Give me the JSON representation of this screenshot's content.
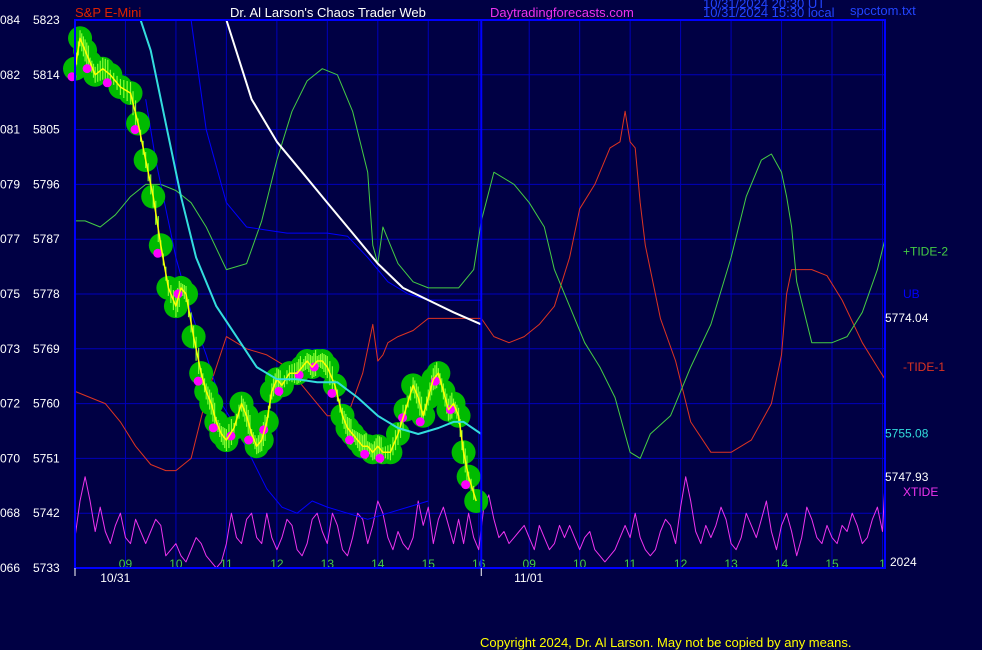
{
  "header": {
    "symbol": "S&P E-Mini",
    "title": "Dr. Al Larson's Chaos Trader Web",
    "site": "Daytradingforecasts.com",
    "ut_line": "10/31/2024 20:30 UT",
    "local_line": "10/31/2024 15:30 local",
    "file": "spcctom.txt"
  },
  "footer": {
    "copyright": "Copyright 2024, Dr. Al Larson. May not be copied by any means."
  },
  "colors": {
    "background": "#000044",
    "grid": "#0000bb",
    "axis": "#0000ff",
    "price": "#ffff00",
    "band": "#00bb00",
    "dots": "#ff00ff",
    "cyan": "#33dddd",
    "white": "#ffffff",
    "blue": "#0000ff",
    "tide_plus": "#44cc44",
    "tide_minus": "#dd3322",
    "xtide": "#ee33ee"
  },
  "chart_data": {
    "type": "line",
    "x_unit": "hour",
    "x_ticks": [
      {
        "hour": 9,
        "label": "09"
      },
      {
        "hour": 10,
        "label": "10"
      },
      {
        "hour": 11,
        "label": "11"
      },
      {
        "hour": 12,
        "label": "12"
      },
      {
        "hour": 13,
        "label": "13"
      },
      {
        "hour": 14,
        "label": "14"
      },
      {
        "hour": 15,
        "label": "15"
      },
      {
        "hour": 16,
        "label": "16"
      },
      {
        "hour": 17,
        "label": "09"
      },
      {
        "hour": 18,
        "label": "10"
      },
      {
        "hour": 19,
        "label": "11"
      },
      {
        "hour": 20,
        "label": "12"
      },
      {
        "hour": 21,
        "label": "13"
      },
      {
        "hour": 22,
        "label": "14"
      },
      {
        "hour": 23,
        "label": "15"
      },
      {
        "hour": 24,
        "label": "1"
      }
    ],
    "date_labels": [
      {
        "hour": 8.5,
        "label": "10/31"
      },
      {
        "hour": 16.7,
        "label": "11/01"
      }
    ],
    "year_label": "2024",
    "xlim": [
      8,
      24.05
    ],
    "ylim": [
      5733,
      5823
    ],
    "y_ticks": [
      {
        "value": 5823,
        "code": "084",
        "label": "5823"
      },
      {
        "value": 5814,
        "code": "082",
        "label": "5814"
      },
      {
        "value": 5805,
        "code": "081",
        "label": "5805"
      },
      {
        "value": 5796,
        "code": "079",
        "label": "5796"
      },
      {
        "value": 5787,
        "code": "077",
        "label": "5787"
      },
      {
        "value": 5778,
        "code": "075",
        "label": "5778"
      },
      {
        "value": 5769,
        "code": "073",
        "label": "5769"
      },
      {
        "value": 5760,
        "code": "072",
        "label": "5760"
      },
      {
        "value": 5751,
        "code": "070",
        "label": "5751"
      },
      {
        "value": 5742,
        "code": "068",
        "label": "5742"
      },
      {
        "value": 5733,
        "code": "066",
        "label": "5733"
      }
    ],
    "divider_hour": 16.05,
    "right_labels": [
      {
        "text": "+TIDE-2",
        "value": 5785,
        "color": "#44cc44"
      },
      {
        "text": "UB",
        "value": 5778,
        "color": "#0000ff"
      },
      {
        "text": "5774.04",
        "value": 5774.04,
        "color": "#ffffff"
      },
      {
        "text": "-TIDE-1",
        "value": 5766,
        "color": "#dd3322"
      },
      {
        "text": "5755.08",
        "value": 5755.08,
        "color": "#33dddd"
      },
      {
        "text": "5747.93",
        "value": 5747.93,
        "color": "#ffffff"
      },
      {
        "text": "XTIDE",
        "value": 5745.5,
        "color": "#ee33ee"
      }
    ],
    "series": [
      {
        "key": "price",
        "x": [
          8,
          8.1,
          8.2,
          8.3,
          8.4,
          8.55,
          8.7,
          8.9,
          9.1,
          9.25,
          9.4,
          9.55,
          9.7,
          9.85,
          10,
          10.1,
          10.2,
          10.35,
          10.5,
          10.6,
          10.7,
          10.8,
          10.9,
          11,
          11.15,
          11.3,
          11.4,
          11.5,
          11.6,
          11.7,
          11.8,
          11.9,
          12,
          12.1,
          12.25,
          12.4,
          12.5,
          12.6,
          12.7,
          12.8,
          12.9,
          13,
          13.15,
          13.3,
          13.4,
          13.5,
          13.6,
          13.7,
          13.8,
          13.9,
          14,
          14.1,
          14.25,
          14.4,
          14.55,
          14.7,
          14.8,
          14.9,
          15,
          15.1,
          15.2,
          15.3,
          15.4,
          15.5,
          15.6,
          15.7,
          15.8,
          15.95
        ],
        "y": [
          5815,
          5820,
          5818,
          5816,
          5814,
          5815,
          5814,
          5812,
          5811,
          5806,
          5800,
          5794,
          5786,
          5779,
          5776,
          5779,
          5778,
          5771,
          5765,
          5762,
          5760,
          5757,
          5755,
          5754,
          5756,
          5760,
          5758,
          5755,
          5753,
          5754,
          5757,
          5762,
          5764,
          5763,
          5765,
          5765,
          5766,
          5767,
          5766,
          5767,
          5767,
          5766,
          5763,
          5758,
          5756,
          5755,
          5754,
          5753,
          5753,
          5752,
          5753,
          5752,
          5752,
          5755,
          5759,
          5763,
          5761,
          5758,
          5761,
          5764,
          5765,
          5762,
          5759,
          5760,
          5758,
          5752,
          5748,
          5744
        ]
      },
      {
        "key": "cyan_avg",
        "x": [
          9.3,
          9.5,
          9.8,
          10.1,
          10.4,
          10.8,
          11.2,
          11.6,
          12,
          12.4,
          12.8,
          13.2,
          13.6,
          14,
          14.4,
          14.8,
          15.2,
          15.5,
          15.7,
          16.05
        ],
        "y": [
          5823,
          5818,
          5806,
          5794,
          5784,
          5776,
          5771,
          5766,
          5764,
          5764,
          5763.5,
          5763.5,
          5761,
          5758,
          5756,
          5755,
          5756,
          5757,
          5757,
          5755
        ]
      },
      {
        "key": "white_avg",
        "x": [
          11,
          11.5,
          12,
          12.5,
          13,
          13.5,
          14,
          14.5,
          15,
          15.5,
          16.05
        ],
        "y": [
          5823,
          5810,
          5803,
          5798,
          5793,
          5788,
          5783,
          5779,
          5777,
          5775,
          5773
        ]
      },
      {
        "key": "ub_line",
        "x": [
          10.3,
          10.6,
          11,
          11.4,
          11.8,
          12.2,
          12.6,
          13,
          13.4,
          13.8,
          14.2,
          14.6,
          15,
          15.4,
          15.8,
          16.05
        ],
        "y": [
          5823,
          5805,
          5793,
          5789,
          5788.5,
          5788,
          5788,
          5788,
          5787.5,
          5784,
          5780,
          5778,
          5777,
          5777,
          5777,
          5777
        ]
      },
      {
        "key": "lb_line",
        "x": [
          9.4,
          9.6,
          9.8,
          10,
          10.3,
          10.6,
          10.9,
          11.2,
          11.5,
          11.8,
          12.1,
          12.4,
          12.7,
          13,
          13.4,
          13.8,
          14.2,
          14.6,
          15
        ],
        "y": [
          5810,
          5800,
          5792,
          5784,
          5775,
          5768,
          5760,
          5756,
          5751,
          5746,
          5743,
          5742,
          5744,
          5743,
          5742,
          5741,
          5742,
          5743,
          5744
        ]
      },
      {
        "key": "tide_plus",
        "x": [
          8,
          8.2,
          8.5,
          8.8,
          9.1,
          9.4,
          9.7,
          10,
          10.3,
          10.6,
          11,
          11.4,
          11.7,
          12,
          12.3,
          12.6,
          12.9,
          13.2,
          13.5,
          13.8,
          13.9,
          14,
          14.1,
          14.2,
          14.4,
          14.7,
          15,
          15.3,
          15.6,
          15.9,
          16.05,
          16.3,
          16.7,
          17,
          17.3,
          17.5,
          17.8,
          18.1,
          18.4,
          18.7,
          19,
          19.2,
          19.4,
          19.8,
          20.2,
          20.6,
          21,
          21.3,
          21.6,
          21.8,
          22,
          22.1,
          22.2,
          22.3,
          22.6,
          23,
          23.3,
          23.6,
          23.9,
          24.05
        ],
        "y": [
          5790,
          5790,
          5789,
          5791,
          5794,
          5796,
          5796,
          5795,
          5793,
          5789,
          5782,
          5783,
          5790,
          5800,
          5808,
          5813,
          5815,
          5814,
          5808,
          5798,
          5786,
          5783,
          5789,
          5787,
          5783,
          5780,
          5779,
          5779,
          5779,
          5782,
          5790,
          5798,
          5796,
          5793,
          5789,
          5782,
          5776,
          5770,
          5766,
          5761,
          5752,
          5751,
          5755,
          5758,
          5766,
          5773,
          5784,
          5794,
          5800,
          5801,
          5798,
          5794,
          5789,
          5780,
          5770,
          5770,
          5771,
          5775,
          5782,
          5787
        ]
      },
      {
        "key": "tide_minus",
        "x": [
          8,
          8.3,
          8.6,
          8.9,
          9.2,
          9.5,
          9.8,
          10,
          10.3,
          10.6,
          11,
          11.4,
          11.8,
          12.2,
          12.6,
          13,
          13.4,
          13.7,
          13.9,
          14,
          14.1,
          14.2,
          14.4,
          14.7,
          15,
          15.3,
          15.6,
          15.9,
          16.05,
          16.3,
          16.6,
          16.9,
          17.2,
          17.5,
          17.8,
          18,
          18.3,
          18.6,
          18.8,
          18.9,
          19,
          19.1,
          19.2,
          19.3,
          19.6,
          19.9,
          20.2,
          20.6,
          21,
          21.4,
          21.8,
          22,
          22.1,
          22.2,
          22.3,
          22.6,
          22.9,
          23.2,
          23.6,
          23.9,
          24.05
        ],
        "y": [
          5762,
          5761,
          5760,
          5757,
          5753,
          5750,
          5749,
          5749,
          5751,
          5761,
          5771,
          5769,
          5768,
          5766,
          5762,
          5758,
          5758,
          5765,
          5773,
          5767,
          5768,
          5770,
          5771,
          5772,
          5774,
          5774,
          5774,
          5774,
          5774,
          5771,
          5770,
          5771,
          5773,
          5776,
          5784,
          5792,
          5796,
          5802,
          5803,
          5808,
          5803,
          5802,
          5793,
          5786,
          5774,
          5767,
          5757,
          5752,
          5752,
          5754,
          5760,
          5768,
          5778,
          5782,
          5782,
          5782,
          5781,
          5777,
          5770,
          5766,
          5764
        ]
      },
      {
        "key": "xtide",
        "x": [
          8,
          8.1,
          8.2,
          8.3,
          8.4,
          8.5,
          8.6,
          8.7,
          8.8,
          8.9,
          9,
          9.1,
          9.2,
          9.3,
          9.4,
          9.5,
          9.6,
          9.7,
          9.8,
          9.9,
          10,
          10.1,
          10.2,
          10.3,
          10.4,
          10.5,
          10.6,
          10.7,
          10.8,
          10.9,
          11,
          11.1,
          11.2,
          11.3,
          11.4,
          11.5,
          11.6,
          11.7,
          11.8,
          11.9,
          12,
          12.1,
          12.2,
          12.3,
          12.4,
          12.5,
          12.6,
          12.7,
          12.8,
          12.9,
          13,
          13.1,
          13.2,
          13.3,
          13.4,
          13.5,
          13.6,
          13.7,
          13.8,
          13.9,
          14,
          14.1,
          14.2,
          14.3,
          14.4,
          14.5,
          14.6,
          14.7,
          14.8,
          14.9,
          15,
          15.1,
          15.2,
          15.3,
          15.4,
          15.5,
          15.6,
          15.7,
          15.8,
          15.9,
          16,
          16.1,
          16.2,
          16.3,
          16.4,
          16.5,
          16.6,
          16.7,
          16.8,
          16.9,
          17,
          17.1,
          17.2,
          17.3,
          17.4,
          17.5,
          17.6,
          17.7,
          17.8,
          17.9,
          18,
          18.1,
          18.2,
          18.3,
          18.4,
          18.5,
          18.6,
          18.7,
          18.8,
          18.9,
          19,
          19.1,
          19.2,
          19.3,
          19.4,
          19.5,
          19.6,
          19.7,
          19.8,
          19.9,
          20,
          20.1,
          20.2,
          20.3,
          20.4,
          20.5,
          20.6,
          20.7,
          20.8,
          20.9,
          21,
          21.1,
          21.2,
          21.3,
          21.4,
          21.5,
          21.6,
          21.7,
          21.8,
          21.9,
          22,
          22.1,
          22.2,
          22.3,
          22.4,
          22.5,
          22.6,
          22.7,
          22.8,
          22.9,
          23,
          23.1,
          23.2,
          23.3,
          23.4,
          23.5,
          23.6,
          23.7,
          23.8,
          23.9,
          24,
          24.05
        ],
        "y": [
          5738,
          5744,
          5748,
          5744,
          5739,
          5743,
          5739,
          5737,
          5740,
          5742,
          5738,
          5737,
          5741,
          5739,
          5737,
          5739,
          5741,
          5740,
          5735,
          5736,
          5737,
          5735,
          5734,
          5736,
          5738,
          5737,
          5735,
          5734,
          5733,
          5734,
          5737,
          5742,
          5738,
          5737,
          5741,
          5742,
          5738,
          5737,
          5742,
          5738,
          5736,
          5738,
          5741,
          5740,
          5736,
          5735,
          5737,
          5741,
          5742,
          5739,
          5737,
          5742,
          5740,
          5736,
          5735,
          5738,
          5742,
          5741,
          5737,
          5740,
          5744,
          5742,
          5738,
          5736,
          5739,
          5737,
          5736,
          5738,
          5744,
          5740,
          5743,
          5737,
          5741,
          5743,
          5740,
          5737,
          5741,
          5737,
          5742,
          5738,
          5736,
          5743,
          5745,
          5741,
          5738,
          5739,
          5737,
          5738,
          5739,
          5740,
          5738,
          5736,
          5740,
          5738,
          5736,
          5737,
          5740,
          5738,
          5740,
          5738,
          5736,
          5738,
          5739,
          5736,
          5735,
          5734,
          5735,
          5736,
          5738,
          5740,
          5738,
          5742,
          5738,
          5736,
          5735,
          5736,
          5739,
          5741,
          5740,
          5737,
          5743,
          5748,
          5744,
          5739,
          5737,
          5740,
          5738,
          5740,
          5743,
          5741,
          5737,
          5736,
          5738,
          5742,
          5740,
          5738,
          5741,
          5744,
          5739,
          5736,
          5740,
          5742,
          5739,
          5735,
          5738,
          5743,
          5741,
          5738,
          5737,
          5740,
          5738,
          5737,
          5740,
          5739,
          5742,
          5740,
          5737,
          5738,
          5741,
          5743,
          5739,
          5747
        ]
      }
    ]
  }
}
